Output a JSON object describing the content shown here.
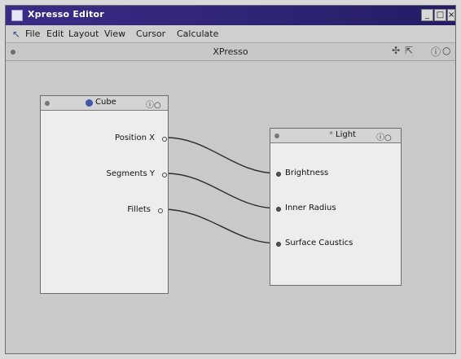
{
  "window": {
    "title": "Xpresso Editor"
  },
  "window_controls": [
    "_",
    "□",
    "×"
  ],
  "menu": [
    "File",
    "Edit",
    "Layout",
    "View",
    "Cursor",
    "Calculate"
  ],
  "toolbar": {
    "view_title": "XPresso",
    "tool_icons": [
      "move-icon",
      "scale-icon",
      "info-icon"
    ]
  },
  "nodes": {
    "cube": {
      "title": "Cube",
      "outputs": [
        "Position X",
        "Segments Y",
        "Fillets"
      ]
    },
    "light": {
      "title": "Light",
      "inputs": [
        "Brightness",
        "Inner Radius",
        "Surface Caustics"
      ]
    }
  },
  "connections": [
    [
      "Position X",
      "Brightness"
    ],
    [
      "Segments Y",
      "Inner Radius"
    ],
    [
      "Fillets",
      "Surface Caustics"
    ]
  ],
  "colors": {
    "title_bar": "#2f2577",
    "object_icon": "#3f57a7",
    "canvas": "#c9c9c9",
    "node_body": "#ededed"
  }
}
